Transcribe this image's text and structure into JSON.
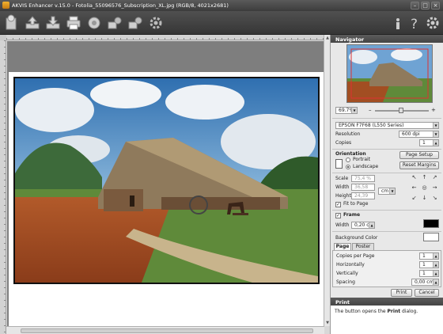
{
  "window": {
    "title": "AKVIS Enhancer v.15.0 - Fotolia_55096576_Subscription_XL.jpg (RGB/8, 4021x2681)",
    "min": "–",
    "max": "□",
    "close": "×"
  },
  "navigator": {
    "title": "Navigator",
    "zoom": "69.7%",
    "zoom_minus": "–",
    "zoom_plus": "+"
  },
  "print": {
    "printer": "EPSON F7F68 (L550 Series)",
    "resolution_label": "Resolution",
    "resolution_value": "600 dpi",
    "copies_label": "Copies",
    "copies_value": "1",
    "orientation_label": "Orientation",
    "portrait": "Portrait",
    "landscape": "Landscape",
    "page_setup": "Page Setup",
    "reset_margins": "Reset Margins",
    "scale_label": "Scale",
    "scale_value": "75,4 %",
    "width_label": "Width",
    "width_value": "36,58",
    "height_label": "Height",
    "height_value": "24,39",
    "units": "cm",
    "fit_to_page": "Fit to Page",
    "frame_label": "Frame",
    "frame_width_label": "Width",
    "frame_width_value": "0,20 cm",
    "frame_color": "#000000",
    "bg_color_label": "Background Color",
    "bg_color": "#ffffff",
    "tabs": [
      "Page",
      "Poster"
    ],
    "copies_per_page_label": "Copies per Page",
    "copies_per_page": "1",
    "horizontally_label": "Horizontally",
    "horizontally": "1",
    "vertically_label": "Vertically",
    "vertically": "1",
    "spacing_label": "Spacing",
    "spacing": "0,00 cm",
    "print_btn": "Print",
    "cancel_btn": "Cancel"
  },
  "help": {
    "title": "Print",
    "text_before": "The button opens the ",
    "text_bold": "Print",
    "text_after": " dialog."
  },
  "icons": [
    "app-logo-icon",
    "open-icon",
    "save-icon",
    "print-icon",
    "share-icon",
    "batch-icon",
    "presets-icon",
    "settings-icon",
    "info-icon",
    "help-icon",
    "preferences-icon",
    "home-icon"
  ]
}
